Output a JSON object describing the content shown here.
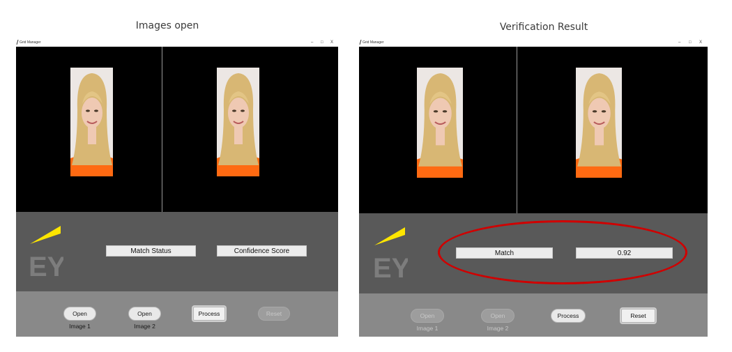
{
  "left": {
    "caption": "Images open",
    "window_title": "Grid Manager",
    "controls": {
      "minimize": "–",
      "maximize": "□",
      "close": "X"
    },
    "match_label": "Match Status",
    "score_label": "Confidence Score",
    "buttons": {
      "open1": "Open Image 1",
      "open2": "Open Image 2",
      "process": "Process",
      "reset": "Reset"
    }
  },
  "right": {
    "caption": "Verification Result",
    "window_title": "Grid Manager",
    "controls": {
      "minimize": "–",
      "maximize": "□",
      "close": "X"
    },
    "match_label": "Match",
    "score_label": "0.92",
    "buttons": {
      "open1": "Open Image 1",
      "open2": "Open Image 2",
      "process": "Process",
      "reset": "Reset"
    }
  },
  "logo_text": "EY",
  "colors": {
    "logo_yellow": "#ffe600",
    "logo_gray": "#7d7d7d",
    "highlight": "#d00000"
  }
}
